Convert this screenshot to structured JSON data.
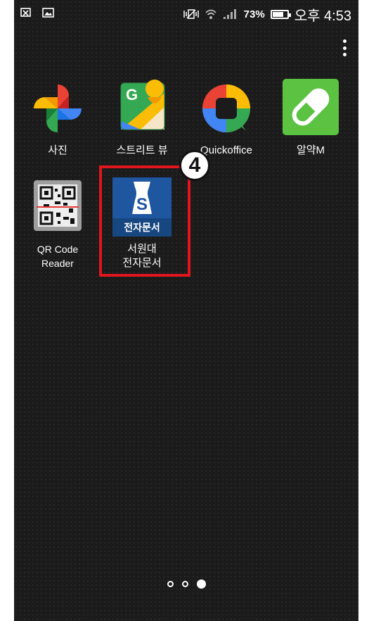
{
  "status_bar": {
    "battery_percent": "73%",
    "time": "오후 4:53",
    "battery_level": 0.73
  },
  "apps": [
    {
      "label": "사진",
      "icon": "google-photos-icon"
    },
    {
      "label": "스트리트 뷰",
      "icon": "street-view-icon"
    },
    {
      "label": "Quickoffice",
      "icon": "quickoffice-icon"
    },
    {
      "label": "알약M",
      "icon": "alyac-m-icon"
    },
    {
      "label": "QR Code\nReader",
      "icon": "qr-code-reader-icon"
    },
    {
      "label": "서원대\n전자문서",
      "icon": "seowon-edoc-icon",
      "icon_text": "전자문서",
      "icon_letter": "S"
    }
  ],
  "annotation": {
    "step": "4",
    "highlight_color": "#e0161c"
  },
  "pager": {
    "pages": 3,
    "current": 3
  },
  "colors": {
    "background": "#1b1b1b",
    "accent_blue": "#1e56a0"
  }
}
